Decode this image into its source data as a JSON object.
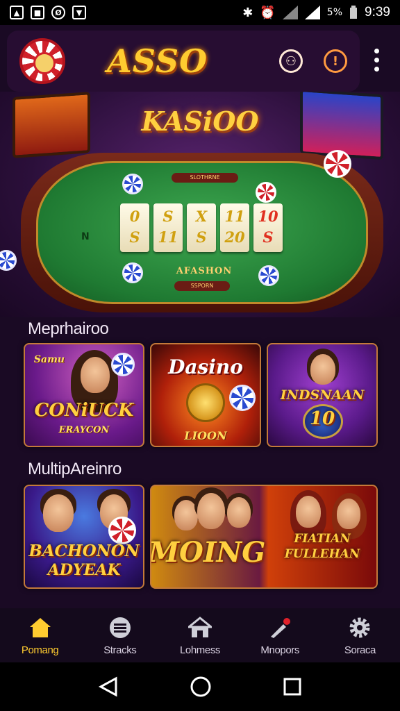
{
  "status_bar": {
    "left_icons": [
      "image-icon",
      "message-icon",
      "nfc-icon",
      "download-icon"
    ],
    "right_icons": [
      "bluetooth-icon",
      "alarm-icon",
      "signal-icon",
      "wifi-icon",
      "battery-icon"
    ],
    "signal_text": "5%",
    "time": "9:39"
  },
  "app_bar": {
    "title": "ASSO",
    "actions": [
      "support-icon",
      "alert-icon",
      "more-vert-icon"
    ]
  },
  "hero": {
    "title": "KASiOO",
    "felt_plate": "SLOTHRNE",
    "felt_n": "N",
    "cards": [
      "0",
      "S",
      "S",
      "11",
      "X",
      "S",
      "11",
      "20",
      "10",
      "S"
    ],
    "felt_label": "AFASHON",
    "felt_plate2": "SSPORN"
  },
  "sections": [
    {
      "title": "Meprhairoo",
      "tiles": [
        {
          "tag": "Samu",
          "main": "CONiUCK",
          "sub": "ERAYCON"
        },
        {
          "main": "Dasino",
          "sub": "LIOON"
        },
        {
          "main": "INDSNAAN",
          "sub": "10"
        }
      ]
    },
    {
      "title": "MultipAreinro",
      "tiles": [
        {
          "main": "BACHONON",
          "sub": "ADYEAK"
        },
        {
          "main": "MOING"
        },
        {
          "main": "FIATIAN",
          "sub": "FULLEHAN"
        }
      ]
    }
  ],
  "bottom_nav": [
    {
      "label": "Pomang",
      "icon": "home-icon",
      "active": true
    },
    {
      "label": "Stracks",
      "icon": "chip-stack-icon",
      "active": false
    },
    {
      "label": "Lohmess",
      "icon": "store-icon",
      "active": false
    },
    {
      "label": "Mnopors",
      "icon": "pen-notification-icon",
      "active": false
    },
    {
      "label": "Soraca",
      "icon": "gear-icon",
      "active": false
    }
  ],
  "system_nav": [
    "back-icon",
    "home-circle-icon",
    "recents-icon"
  ],
  "colors": {
    "accent": "#ffcc30",
    "background": "#1a0a24",
    "felt": "#1f7a32"
  }
}
